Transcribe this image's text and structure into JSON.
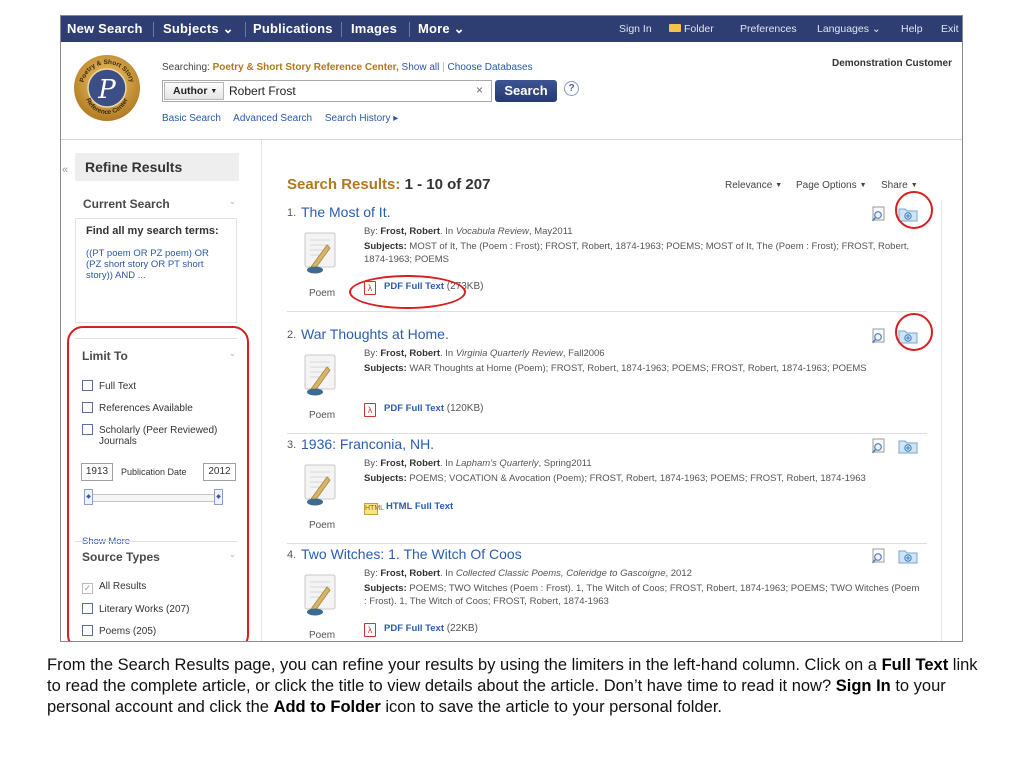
{
  "nav": {
    "left": [
      "New Search",
      "Subjects ⌄",
      "Publications",
      "Images",
      "More ⌄"
    ],
    "right": [
      "Sign In",
      "Folder",
      "Preferences",
      "Languages ⌄",
      "Help",
      "Exit"
    ]
  },
  "search": {
    "searching_label": "Searching:",
    "database": "Poetry & Short Story Reference Center,",
    "show_all": "Show all",
    "choose_databases": "Choose Databases",
    "field": "Author",
    "query": "Robert Frost",
    "button": "Search",
    "help": "?",
    "links": [
      "Basic Search",
      "Advanced Search",
      "Search History ▸"
    ],
    "customer": "Demonstration Customer"
  },
  "logo": {
    "text_top": "Poetry & Short Story",
    "letter": "P",
    "text_bottom": "Reference Center"
  },
  "sidebar": {
    "collapse": "«",
    "title": "Refine Results",
    "current_search": {
      "title": "Current Search",
      "find_all": "Find all my search terms:",
      "query": "((PT poem OR PZ poem) OR (PZ short story OR PT short story)) AND ..."
    },
    "limit_to": {
      "title": "Limit To",
      "items": [
        "Full Text",
        "References Available",
        "Scholarly (Peer Reviewed)",
        "Journals"
      ],
      "year_from": "1913",
      "year_to": "2012",
      "pub_date_label": "Publication Date",
      "show_more": "Show More"
    },
    "source_types": {
      "title": "Source Types",
      "items": [
        "All Results",
        "Literary Works (207)",
        "Poems (205)"
      ]
    }
  },
  "results": {
    "header_label": "Search Results:",
    "header_range": "1 - 10 of 207",
    "options": [
      "Relevance",
      "Page Options",
      "Share"
    ],
    "items": [
      {
        "num": "1.",
        "title": "The Most of It.",
        "by": "By: ",
        "author": "Frost, Robert",
        "in": ". In ",
        "source": "Vocabula Review",
        "date": ", May2011",
        "subjects_label": "Subjects:",
        "subjects": " MOST of It, The (Poem : Frost); FROST, Robert, 1874-1963; POEMS; MOST of It, The (Poem : Frost); FROST, Robert, 1874-1963; POEMS",
        "ft_label": "PDF Full Text",
        "ft_size": "(273KB)",
        "type": "Poem"
      },
      {
        "num": "2.",
        "title": "War Thoughts at Home.",
        "by": "By: ",
        "author": "Frost, Robert",
        "in": ". In ",
        "source": "Virginia Quarterly Review",
        "date": ", Fall2006",
        "subjects_label": "Subjects:",
        "subjects": " WAR Thoughts at Home (Poem); FROST, Robert, 1874-1963; POEMS; FROST, Robert, 1874-1963; POEMS",
        "ft_label": "PDF Full Text",
        "ft_size": "(120KB)",
        "type": "Poem"
      },
      {
        "num": "3.",
        "title": "1936: Franconia, NH.",
        "by": "By: ",
        "author": "Frost, Robert",
        "in": ". In ",
        "source": "Lapham's Quarterly",
        "date": ", Spring2011",
        "subjects_label": "Subjects:",
        "subjects": " POEMS; VOCATION & Avocation (Poem); FROST, Robert, 1874-1963; POEMS; FROST, Robert, 1874-1963",
        "ft_label": "HTML Full Text",
        "ft_size": "",
        "type": "Poem"
      },
      {
        "num": "4.",
        "title": "Two Witches: 1. The Witch Of Coos",
        "by": "By: ",
        "author": "Frost, Robert",
        "in": ". In ",
        "source": "Collected Classic Poems, Coleridge to Gascoigne",
        "date": ", 2012",
        "subjects_label": "Subjects:",
        "subjects": " POEMS; TWO Witches (Poem : Frost). 1, The Witch of Coos; FROST, Robert, 1874-1963; POEMS; TWO Witches (Poem : Frost). 1, The Witch of Coos; FROST, Robert, 1874-1963",
        "ft_label": "PDF Full Text",
        "ft_size": "(22KB)",
        "type": "Poem"
      }
    ]
  },
  "caption": {
    "p1": "From the Search Results page, you can refine your results by using the limiters in the left-hand column. Click on a ",
    "b1": "Full Text",
    "p2": " link to read the complete article, or click the title to view details about the article. Don’t have time to read it now? ",
    "b2": "Sign In",
    "p3": " to your personal account and click the ",
    "b3": "Add to Folder",
    "p4": " icon to save the article to your personal folder."
  },
  "colors": {
    "nav_bg": "#2f3e72",
    "accent_gold": "#b07820",
    "link_blue": "#2a5db0",
    "annotation_red": "#d81e1e"
  }
}
